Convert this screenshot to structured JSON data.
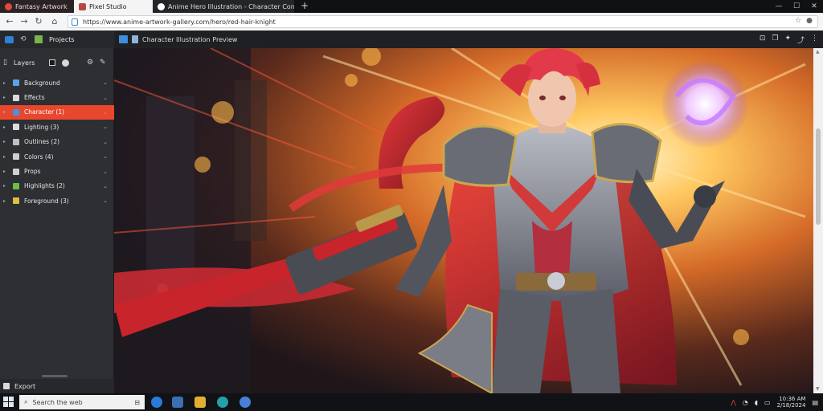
{
  "browser": {
    "tabs": [
      {
        "label": "Fantasy Artwork"
      },
      {
        "label": "Pixel Studio"
      },
      {
        "label": "Anime Hero Illustration - Character Concept"
      }
    ],
    "new_tab_label": "+",
    "tab_close_label": "×",
    "address": {
      "url": "https://www.anime-artwork-gallery.com/hero/red-hair-knight"
    }
  },
  "sidebar": {
    "header_label": "Projects",
    "tools_label": "Layers",
    "items": [
      {
        "label": "Background",
        "color": "#5aa3e8"
      },
      {
        "label": "Effects",
        "color": "#d9d9d9"
      },
      {
        "label": "Character (1)",
        "color": "#4a90e2"
      },
      {
        "label": "Lighting (3)",
        "color": "#dcdcdc"
      },
      {
        "label": "Outlines (2)",
        "color": "#bfbfbf"
      },
      {
        "label": "Colors (4)",
        "color": "#cfcfcf"
      },
      {
        "label": "Props",
        "color": "#d0d0d0"
      },
      {
        "label": "Highlights (2)",
        "color": "#6abf4b"
      },
      {
        "label": "Foreground (3)",
        "color": "#e0c040"
      }
    ],
    "active_index": 2,
    "footer_label": "Export",
    "accent": "#e8472e"
  },
  "content": {
    "title": "Character Illustration Preview"
  },
  "taskbar": {
    "search_placeholder": "Search the web",
    "clock_time": "10:36 AM",
    "clock_date": "2/18/2024"
  }
}
